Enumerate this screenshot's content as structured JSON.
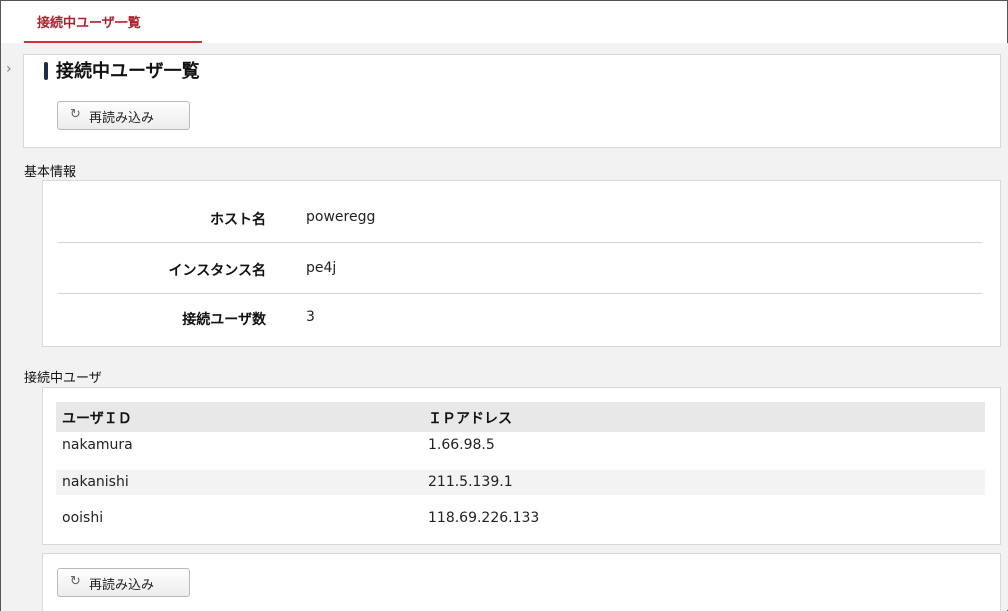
{
  "tab": {
    "label": "接続中ユーザ一覧"
  },
  "page": {
    "title": "接続中ユーザ一覧"
  },
  "buttons": {
    "reload_label": "再読み込み"
  },
  "basic_info": {
    "section_title": "基本情報",
    "rows": [
      {
        "key": "ホスト名",
        "value": "poweregg"
      },
      {
        "key": "インスタンス名",
        "value": "pe4j"
      },
      {
        "key": "接続ユーザ数",
        "value": "3"
      }
    ]
  },
  "connected_users": {
    "section_title": "接続中ユーザ",
    "columns": [
      "ユーザＩＤ",
      "ＩＰアドレス"
    ],
    "rows": [
      {
        "user_id": "nakamura",
        "ip": "1.66.98.5"
      },
      {
        "user_id": "nakanishi",
        "ip": "211.5.139.1"
      },
      {
        "user_id": "ooishi",
        "ip": "118.69.226.133"
      }
    ]
  },
  "colors": {
    "accent": "#c8353e",
    "title_marker": "#1b2f4d"
  }
}
